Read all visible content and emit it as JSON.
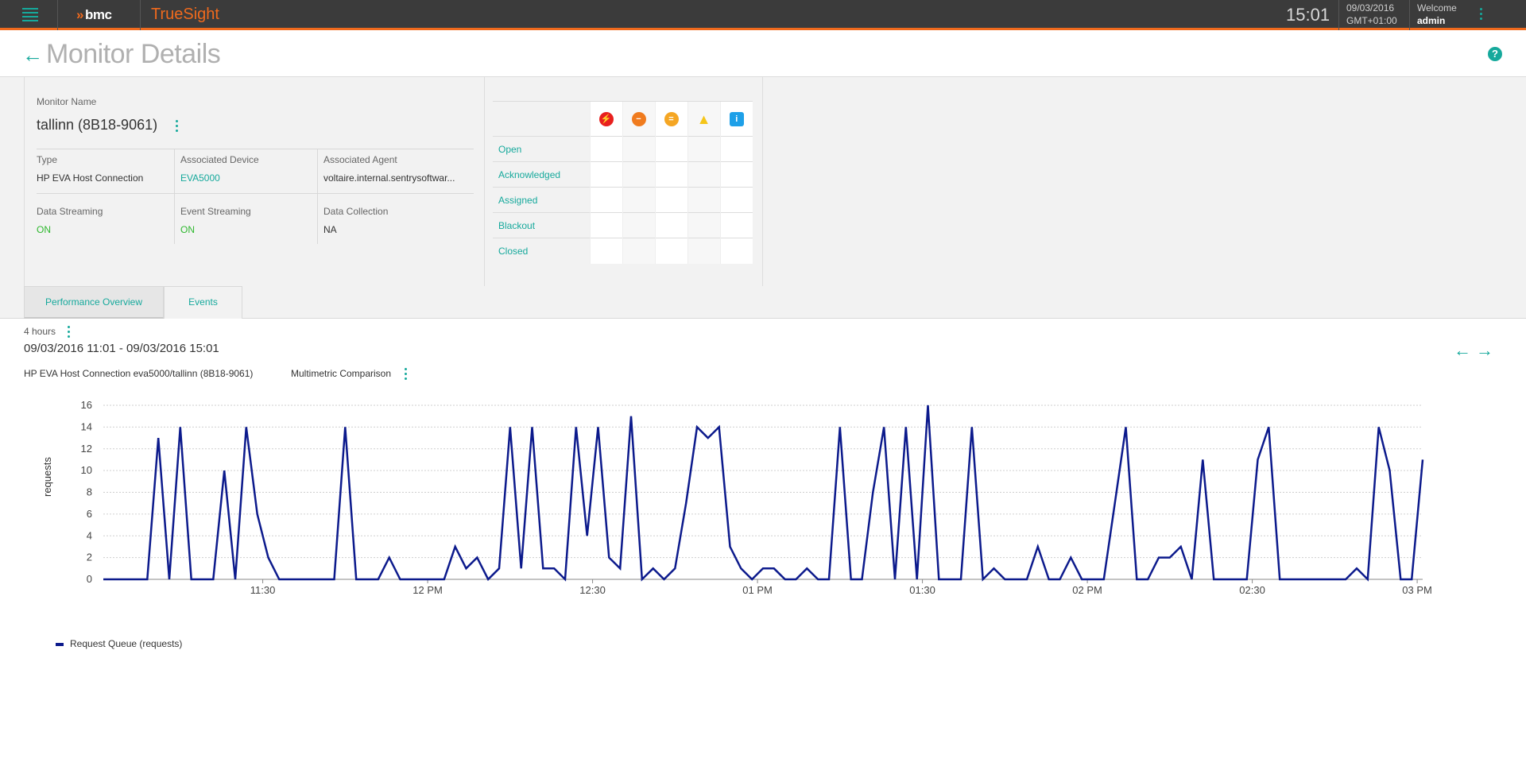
{
  "header": {
    "brand": "bmc",
    "product": "TrueSight",
    "time": "15:01",
    "date": "09/03/2016",
    "timezone": "GMT+01:00",
    "welcome_label": "Welcome",
    "user": "admin"
  },
  "page": {
    "title": "Monitor Details"
  },
  "monitor": {
    "name_label": "Monitor Name",
    "name": "tallinn (8B18-9061)",
    "type_label": "Type",
    "type": "HP EVA Host Connection",
    "device_label": "Associated Device",
    "device": "EVA5000",
    "agent_label": "Associated Agent",
    "agent": "voltaire.internal.sentrysoftwar...",
    "data_streaming_label": "Data Streaming",
    "data_streaming": "ON",
    "event_streaming_label": "Event Streaming",
    "event_streaming": "ON",
    "data_collection_label": "Data Collection",
    "data_collection": "NA"
  },
  "events": {
    "severity_icons": [
      {
        "name": "critical-icon",
        "color": "#e8201e",
        "glyph": "⚡"
      },
      {
        "name": "major-icon",
        "color": "#f07b1e",
        "glyph": "−"
      },
      {
        "name": "minor-icon",
        "color": "#f5a623",
        "glyph": "="
      },
      {
        "name": "warning-icon",
        "color": "#f5c518",
        "glyph": "!"
      },
      {
        "name": "info-icon",
        "color": "#1ea0e8",
        "glyph": "i"
      }
    ],
    "rows": [
      "Open",
      "Acknowledged",
      "Assigned",
      "Blackout",
      "Closed"
    ]
  },
  "tabs": {
    "performance": "Performance Overview",
    "events": "Events"
  },
  "time_range": {
    "label": "4 hours",
    "dates": "09/03/2016 11:01 - 09/03/2016 15:01"
  },
  "chart_header": {
    "title": "HP EVA Host Connection eva5000/tallinn (8B18-9061)",
    "mode": "Multimetric Comparison"
  },
  "chart_data": {
    "type": "line",
    "ylabel": "requests",
    "ylim": [
      0,
      16
    ],
    "yticks": [
      0,
      2,
      4,
      6,
      8,
      10,
      12,
      14,
      16
    ],
    "xlim_minutes": [
      0,
      240
    ],
    "xticks": [
      {
        "minute": 29,
        "label": "11:30"
      },
      {
        "minute": 59,
        "label": "12 PM"
      },
      {
        "minute": 89,
        "label": "12:30"
      },
      {
        "minute": 119,
        "label": "01 PM"
      },
      {
        "minute": 149,
        "label": "01:30"
      },
      {
        "minute": 179,
        "label": "02 PM"
      },
      {
        "minute": 209,
        "label": "02:30"
      },
      {
        "minute": 239,
        "label": "03 PM"
      }
    ],
    "grid": true,
    "series": [
      {
        "name": "Request Queue (requests)",
        "color": "#0c1a8c",
        "values": [
          0,
          0,
          0,
          0,
          0,
          13,
          0,
          14,
          0,
          0,
          0,
          10,
          0,
          14,
          6,
          2,
          0,
          0,
          0,
          0,
          0,
          0,
          14,
          0,
          0,
          0,
          2,
          0,
          0,
          0,
          0,
          0,
          3,
          1,
          2,
          0,
          1,
          14,
          1,
          14,
          1,
          1,
          0,
          14,
          4,
          14,
          2,
          1,
          15,
          0,
          1,
          0,
          1,
          7,
          14,
          13,
          14,
          3,
          1,
          0,
          1,
          1,
          0,
          0,
          1,
          0,
          0,
          14,
          0,
          0,
          8,
          14,
          0,
          14,
          0,
          16,
          0,
          0,
          0,
          14,
          0,
          1,
          0,
          0,
          0,
          3,
          0,
          0,
          2,
          0,
          0,
          0,
          7,
          14,
          0,
          0,
          2,
          2,
          3,
          0,
          11,
          0,
          0,
          0,
          0,
          11,
          14,
          0,
          0,
          0,
          0,
          0,
          0,
          0,
          1,
          0,
          14,
          10,
          0,
          0,
          11
        ]
      }
    ]
  },
  "legend": {
    "items": [
      "Request Queue (requests)"
    ]
  }
}
